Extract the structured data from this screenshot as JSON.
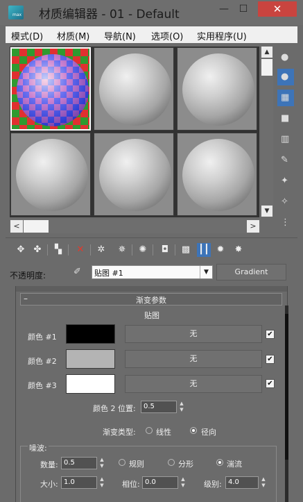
{
  "window": {
    "title": "材质编辑器 - 01 - Default",
    "minimize": "—",
    "maximize": "☐",
    "close": "✕"
  },
  "menu": [
    "模式(D)",
    "材质(M)",
    "导航(N)",
    "选项(O)",
    "实用程序(U)"
  ],
  "preview": {
    "scroll_up": "▲",
    "scroll_down": "▼",
    "scroll_left": "<",
    "scroll_right": ">"
  },
  "opacity": {
    "label": "不透明度:",
    "map_value": "贴图 #1",
    "type_button": "Gradient"
  },
  "rollout": {
    "title": "渐变参数",
    "collapse": "–",
    "maps_header": "贴图",
    "colors": [
      {
        "label": "颜色 #1",
        "swatch": "#000000",
        "map": "无",
        "checked": "✔"
      },
      {
        "label": "颜色 #2",
        "swatch": "#b4b4b4",
        "map": "无",
        "checked": "✔"
      },
      {
        "label": "颜色 #3",
        "swatch": "#ffffff",
        "map": "无",
        "checked": "✔"
      }
    ],
    "color2_pos_label": "颜色 2 位置:",
    "color2_pos_value": "0.5",
    "gradient_type_label": "渐变类型:",
    "gradient_type_linear": "线性",
    "gradient_type_radial": "径向",
    "gradient_type_selected": "radial",
    "noise": {
      "group_label": "噪波:",
      "amount_label": "数量:",
      "amount_value": "0.5",
      "regular": "规则",
      "fractal": "分形",
      "turbulence": "湍流",
      "selected": "turbulence",
      "size_label": "大小:",
      "size_value": "1.0",
      "phase_label": "相位:",
      "phase_value": "0.0",
      "levels_label": "级别:",
      "levels_value": "4.0"
    }
  },
  "colors": {
    "accent": "#3d74b8",
    "close_red": "#c9443f",
    "panel_bg": "#6b6b6b"
  }
}
